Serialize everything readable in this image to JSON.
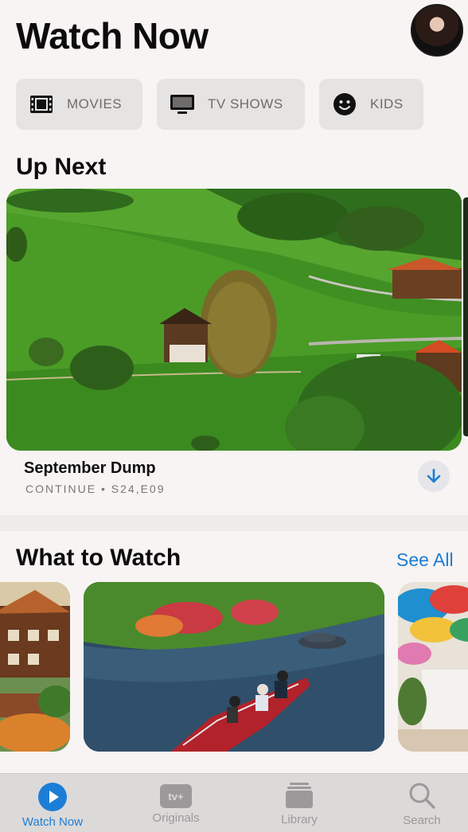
{
  "header": {
    "title": "Watch Now"
  },
  "categories": [
    {
      "label": "MOVIES",
      "icon": "film-icon"
    },
    {
      "label": "TV SHOWS",
      "icon": "tv-icon"
    },
    {
      "label": "KIDS",
      "icon": "smiley-icon"
    }
  ],
  "up_next": {
    "section_title": "Up Next",
    "item": {
      "title": "September Dump",
      "subtitle": "CONTINUE • S24,E09"
    }
  },
  "what_to_watch": {
    "section_title": "What to Watch",
    "see_all_label": "See All"
  },
  "tabbar": {
    "tabs": [
      {
        "label": "Watch Now",
        "active": true,
        "icon": "play-circle-icon"
      },
      {
        "label": "Originals",
        "active": false,
        "icon": "appletv-icon",
        "icon_text": "tv+"
      },
      {
        "label": "Library",
        "active": false,
        "icon": "library-icon"
      },
      {
        "label": "Search",
        "active": false,
        "icon": "search-icon"
      }
    ]
  },
  "colors": {
    "accent": "#1c7ed6",
    "background": "#f7f4f3",
    "pill_bg": "#e6e3e3"
  }
}
